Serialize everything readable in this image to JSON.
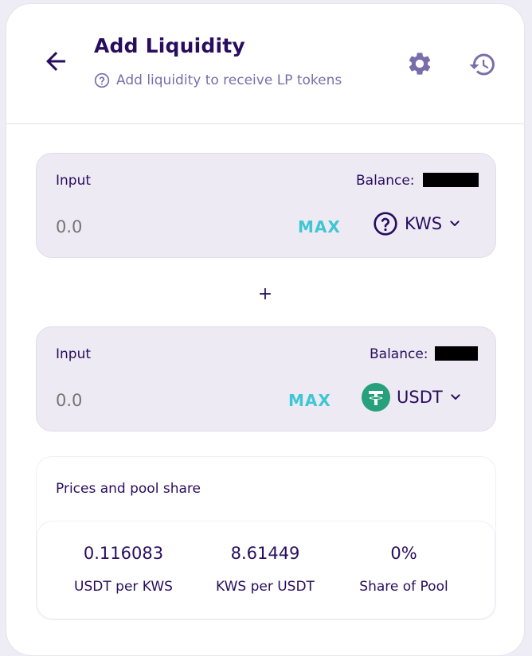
{
  "header": {
    "title": "Add Liquidity",
    "subtitle": "Add liquidity to receive LP tokens"
  },
  "input_a": {
    "label": "Input",
    "balance_label": "Balance:",
    "amount_placeholder": "0.0",
    "max_label": "MAX",
    "token": "KWS"
  },
  "separator": "+",
  "input_b": {
    "label": "Input",
    "balance_label": "Balance:",
    "amount_placeholder": "0.0",
    "max_label": "MAX",
    "token": "USDT"
  },
  "prices": {
    "title": "Prices and pool share",
    "items": [
      {
        "value": "0.116083",
        "label": "USDT per KWS"
      },
      {
        "value": "8.61449",
        "label": "KWS per USDT"
      },
      {
        "value": "0%",
        "label": "Share of Pool"
      }
    ]
  },
  "icons": {
    "back": "arrow-left-icon",
    "help": "question-circle-icon",
    "settings": "gear-icon",
    "history": "history-icon",
    "token_a": "question-circle-icon",
    "token_b": "tether-logo-icon",
    "dropdown": "chevron-down-icon"
  },
  "colors": {
    "primary_text": "#280d5f",
    "secondary_text": "#7a6eaa",
    "accent": "#3fc6d4",
    "panel_bg": "#eeeaf4",
    "tether": "#26a17b"
  }
}
